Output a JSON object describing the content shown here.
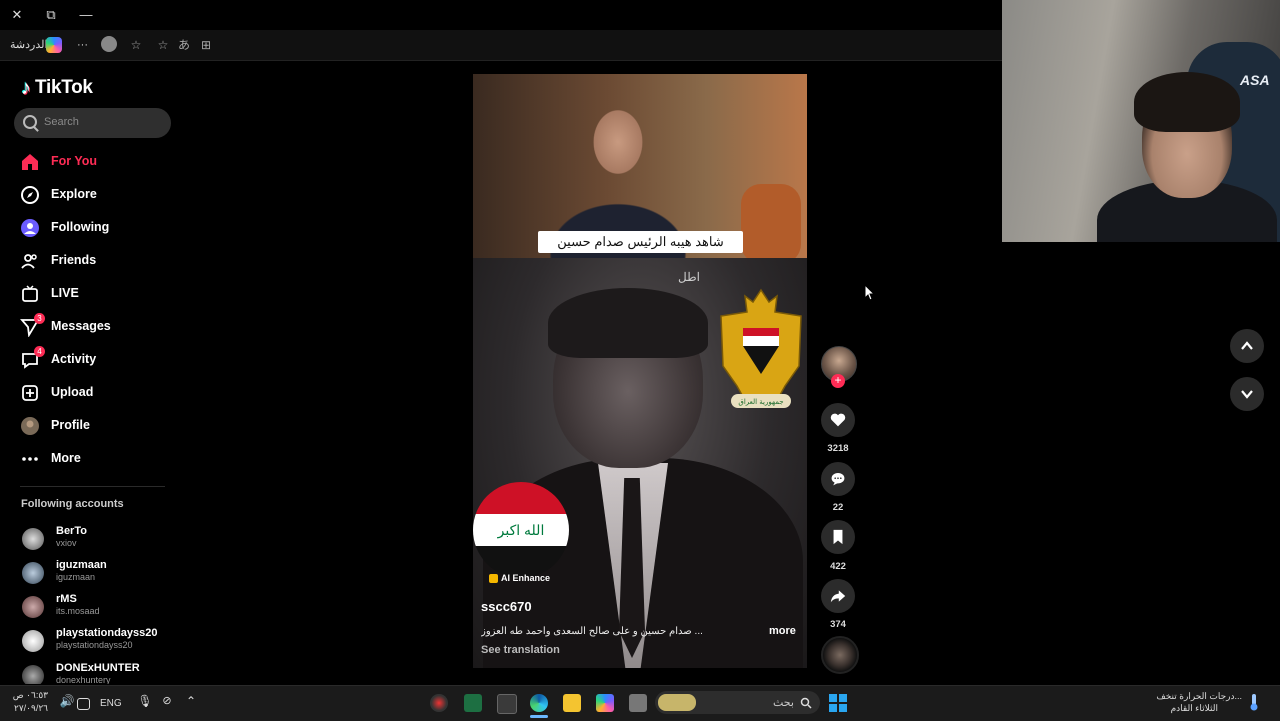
{
  "browser": {
    "close_glyph": "✕",
    "restore_glyph": "⧉",
    "minimize_glyph": "—",
    "chat_label": "الدردشة",
    "more_glyph": "···"
  },
  "sidebar": {
    "logo_text": "TikTok",
    "search_placeholder": "Search",
    "nav": [
      {
        "label": "For You",
        "icon": "home-icon",
        "active": true
      },
      {
        "label": "Explore",
        "icon": "compass-icon"
      },
      {
        "label": "Following",
        "icon": "following-icon"
      },
      {
        "label": "Friends",
        "icon": "friends-icon"
      },
      {
        "label": "LIVE",
        "icon": "live-icon"
      },
      {
        "label": "Messages",
        "icon": "messages-icon",
        "badge": "3"
      },
      {
        "label": "Activity",
        "icon": "activity-icon",
        "badge": "4"
      },
      {
        "label": "Upload",
        "icon": "upload-icon"
      },
      {
        "label": "Profile",
        "icon": "profile-avatar"
      },
      {
        "label": "More",
        "icon": "more-icon"
      }
    ],
    "following_title": "Following accounts",
    "accounts": [
      {
        "name": "BerTo",
        "user": "vxiov"
      },
      {
        "name": "iguzmaan",
        "user": "iguzmaan"
      },
      {
        "name": "rMS",
        "user": "its.mosaad"
      },
      {
        "name": "playstationdayss20",
        "user": "playstationdayss20"
      },
      {
        "name": "DONExHUNTER",
        "user": "donexhuntery"
      }
    ]
  },
  "video": {
    "subtitle": "شاهد هيبه الرئيس صدام حسين",
    "corner_text": "اطل",
    "flag_text": "الله اكبر",
    "ai_label": "AI Enhance",
    "username": "sscc670",
    "caption": "... صدام حسين و على صالح السعدى  وأحمد طه العزوز",
    "more_label": "more",
    "translate_label": "See translation"
  },
  "actions": {
    "likes": "3218",
    "comments": "22",
    "saves": "422",
    "shares": "374"
  },
  "webcam": {
    "chair_brand": "ASA"
  },
  "taskbar": {
    "search_text": "بحث",
    "lang": "ENG",
    "time": "٠٦:٥٣ ص",
    "date": "٢٧/٠٩/٢٦",
    "weather_line1": "درجات الحرارة تنخف...",
    "weather_line2": "الثلاثاء القادم"
  },
  "colors": {
    "accent": "#fe2c55",
    "background": "#000000",
    "panel": "#2b2b2b"
  }
}
